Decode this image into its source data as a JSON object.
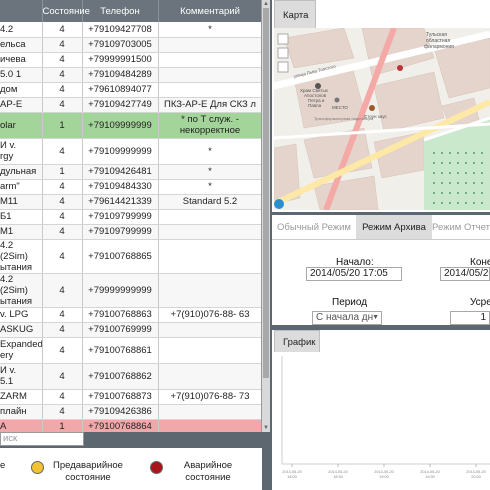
{
  "table": {
    "headers": [
      "",
      "Состояние",
      "Телефон",
      "Комментарий"
    ],
    "rows": [
      {
        "name": "4.2",
        "state": "4",
        "phone": "+79109427708",
        "comment": "*",
        "style": ""
      },
      {
        "name": "ельса",
        "state": "4",
        "phone": "+79109703005",
        "comment": "",
        "style": "alt"
      },
      {
        "name": "ичева",
        "state": "4",
        "phone": "+79999991500",
        "comment": "",
        "style": ""
      },
      {
        "name": "5.0 1",
        "state": "4",
        "phone": "+79109484289",
        "comment": "",
        "style": "alt"
      },
      {
        "name": "дом",
        "state": "4",
        "phone": "+79610894077",
        "comment": "",
        "style": ""
      },
      {
        "name": "АР-Е",
        "state": "4",
        "phone": "+79109427749",
        "comment": "ПКЗ-АР-Е Для СКЗ л",
        "style": "alt"
      },
      {
        "name": "olar",
        "state": "1",
        "phone": "+79109999999",
        "comment": "* по Т служ. -\nнекорректное",
        "style": "green"
      },
      {
        "name": "И v.\nrgy",
        "state": "4",
        "phone": "+79109999999",
        "comment": "*",
        "style": ""
      },
      {
        "name": "дульная",
        "state": "1",
        "phone": "+79109426481",
        "comment": "*",
        "style": "alt"
      },
      {
        "name": "arm\"",
        "state": "4",
        "phone": "+79109484330",
        "comment": "*",
        "style": ""
      },
      {
        "name": "M11",
        "state": "4",
        "phone": "+79614421339",
        "comment": "Standard 5.2",
        "style": "alt"
      },
      {
        "name": "Б1",
        "state": "4",
        "phone": "+79109799999",
        "comment": "",
        "style": ""
      },
      {
        "name": "M1",
        "state": "4",
        "phone": "+79109799999",
        "comment": "",
        "style": "alt"
      },
      {
        "name": "4.2 (2Sim)\nытания",
        "state": "4",
        "phone": "+79100768865",
        "comment": "",
        "style": ""
      },
      {
        "name": "4.2 (2Sim)\nытания",
        "state": "4",
        "phone": "+79999999999",
        "comment": "",
        "style": "alt"
      },
      {
        "name": "v. LPG",
        "state": "4",
        "phone": "+79100768863",
        "comment": "+7(910)076-88- 63",
        "style": ""
      },
      {
        "name": "ASKUG",
        "state": "4",
        "phone": "+79100769999",
        "comment": "",
        "style": "alt"
      },
      {
        "name": "Expanded\nery",
        "state": "4",
        "phone": "+79100768861",
        "comment": "",
        "style": ""
      },
      {
        "name": "И v.\n5.1",
        "state": "4",
        "phone": "+79100768862",
        "comment": "",
        "style": "alt"
      },
      {
        "name": "ZARM",
        "state": "4",
        "phone": "+79100768873",
        "comment": "+7(910)076-88- 73",
        "style": ""
      },
      {
        "name": "плайн",
        "state": "4",
        "phone": "+79109426386",
        "comment": "",
        "style": "alt"
      },
      {
        "name": "А",
        "state": "1",
        "phone": "+79100768864",
        "comment": "",
        "style": "red"
      }
    ]
  },
  "search": {
    "placeholder": "иск"
  },
  "legend": {
    "warning": "Предаварийное\nсостояние",
    "emergency": "Аварийное\nсостояние",
    "normal_fragment": "е"
  },
  "map": {
    "tab": "Карта",
    "labels": {
      "phil": "Тульская\nобластная\nфилармония",
      "church": "Храм Святых\nАпостолов\nПетра и\nПавла",
      "mesto": "МЕСТО",
      "stone": "Стоун хаус",
      "street1": "улица Льва Толстого",
      "street2": "улица Бундурина",
      "street3": "Трансформаторная подстанция",
      "tag": "ЦЭ"
    }
  },
  "modes": {
    "tabs": [
      "Обычный Режим",
      "Режим Архива",
      "Режим Отчет"
    ],
    "start_label": "Начало:",
    "start_value": "2014/05/20 17:05",
    "end_label": "Коне",
    "end_value": "2014/05/20 1",
    "period_label": "Период",
    "period_value": "С начала дн",
    "avg_label": "Усре",
    "avg_value": "1"
  },
  "chart": {
    "tab": "График",
    "x_ticks": [
      "2014-05-20\n18:00",
      "2014-05-20\n18:30",
      "2014-05-20\n19:00",
      "2014-05-20\n19:30",
      "2014-05-20\n20:00"
    ]
  },
  "colors": {
    "green_row": "#a3d49a",
    "red_row": "#f0a8ab",
    "warning_dot": "#f2c230",
    "emergency_dot": "#a8161c",
    "header_bg": "#6b747c"
  }
}
